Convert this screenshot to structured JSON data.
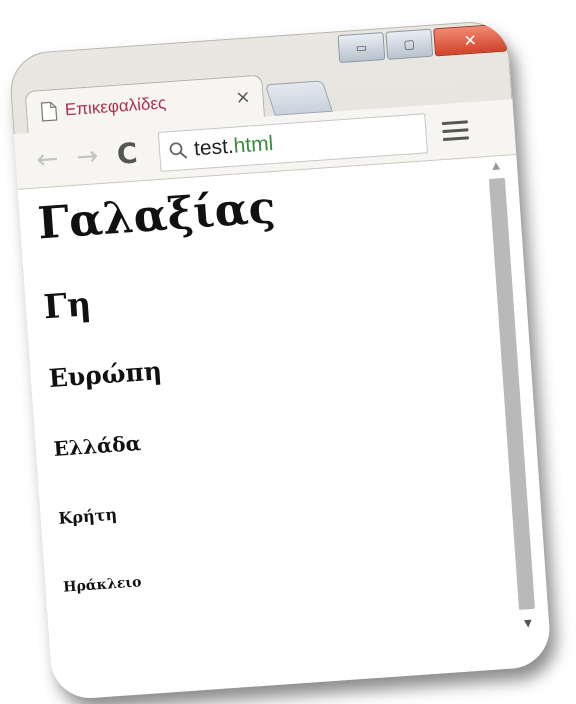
{
  "window": {
    "controls": {
      "minimize_symbol": "▭",
      "maximize_symbol": "▢",
      "close_symbol": "✕"
    }
  },
  "tab": {
    "title": "Επικεφαλίδες",
    "close_symbol": "×",
    "icon": "document-icon"
  },
  "toolbar": {
    "back_symbol": "←",
    "forward_symbol": "→",
    "reload_symbol": "C",
    "url_name": "test.",
    "url_ext": "html",
    "menu_icon": "hamburger-menu-icon"
  },
  "page": {
    "h1": "Γαλαξίας",
    "h2": "Γη",
    "h3": "Ευρώπη",
    "h4": "Ελλάδα",
    "h5": "Κρήτη",
    "h6": "Ηράκλειο"
  },
  "scrollbar": {
    "up_symbol": "▲",
    "down_symbol": "▼"
  },
  "colors": {
    "tab_title": "#b0304a",
    "url_extension": "#3a8a3a",
    "close_button": "#d2432b"
  }
}
